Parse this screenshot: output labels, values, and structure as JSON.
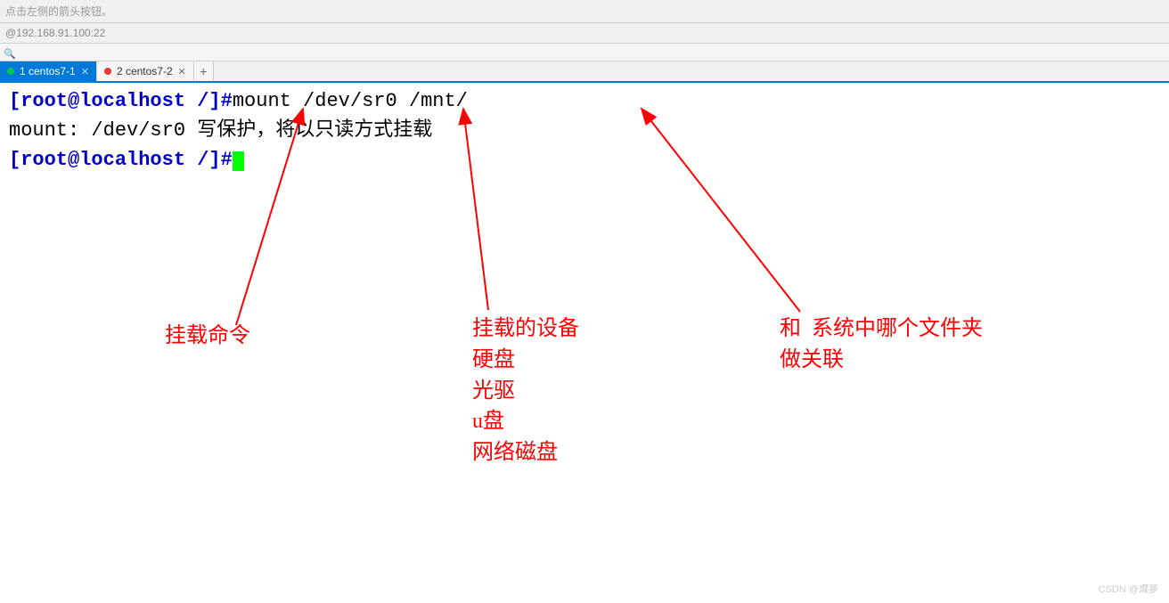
{
  "topbar": {
    "hint": "点击左侧的箭头按钮。"
  },
  "address": "@192.168.91.100:22",
  "tabs": [
    {
      "label": "1 centos7-1",
      "active": true
    },
    {
      "label": "2 centos7-2",
      "active": false
    }
  ],
  "addTab": "+",
  "terminal": {
    "prompt": "[root@localhost /]",
    "hash": "#",
    "command": "mount  /dev/sr0    /mnt/",
    "output": "mount: /dev/sr0 写保护，将以只读方式挂载"
  },
  "annotations": {
    "left": "挂载命令",
    "middle": "挂载的设备\n硬盘\n光驱\nu盘\n网络磁盘",
    "right": "和  系统中哪个文件夹\n做关联"
  },
  "watermark": "CSDN @爛夢",
  "colors": {
    "annotation": "#ff0000",
    "prompt": "#0000cc",
    "cursor": "#00ff00",
    "activeTab": "#0078d7"
  }
}
